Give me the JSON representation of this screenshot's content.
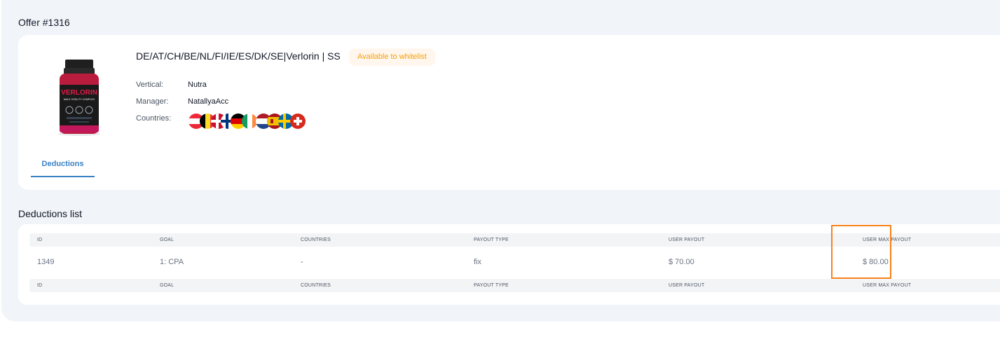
{
  "offer": {
    "title": "Offer #1316",
    "name": "DE/AT/CH/BE/NL/FI/IE/ES/DK/SE|Verlorin | SS",
    "badge": "Available to whitelist",
    "product_image_label": "VERLORIN",
    "product_image_sublabel": "MALE VITALITY COMPLEX",
    "vertical_label": "Vertical:",
    "vertical_value": "Nutra",
    "manager_label": "Manager:",
    "manager_value": "NatallyaAcc",
    "countries_label": "Countries:",
    "country_flags": [
      "AT-flag-icon",
      "BE-flag-icon",
      "DK-flag-icon",
      "FI-flag-icon",
      "DE-flag-icon",
      "IE-flag-icon",
      "NL-flag-icon",
      "ES-flag-icon",
      "SE-flag-icon",
      "CH-flag-icon"
    ]
  },
  "tabs": [
    {
      "label": "Deductions",
      "active": true
    }
  ],
  "deductions": {
    "title": "Deductions list",
    "columns": [
      "ID",
      "GOAL",
      "COUNTRIES",
      "PAYOUT TYPE",
      "USER PAYOUT",
      "USER MAX PAYOUT"
    ],
    "rows": [
      {
        "id": "1349",
        "goal": "1: CPA",
        "countries": "-",
        "payout_type": "fix",
        "user_payout": "$ 70.00",
        "user_max_payout": "$ 80.00"
      }
    ]
  },
  "colors": {
    "accent": "#3b82c4",
    "badge_text": "#f59e0b",
    "highlight": "#f7821b",
    "page_bg": "#f1f5f9"
  }
}
